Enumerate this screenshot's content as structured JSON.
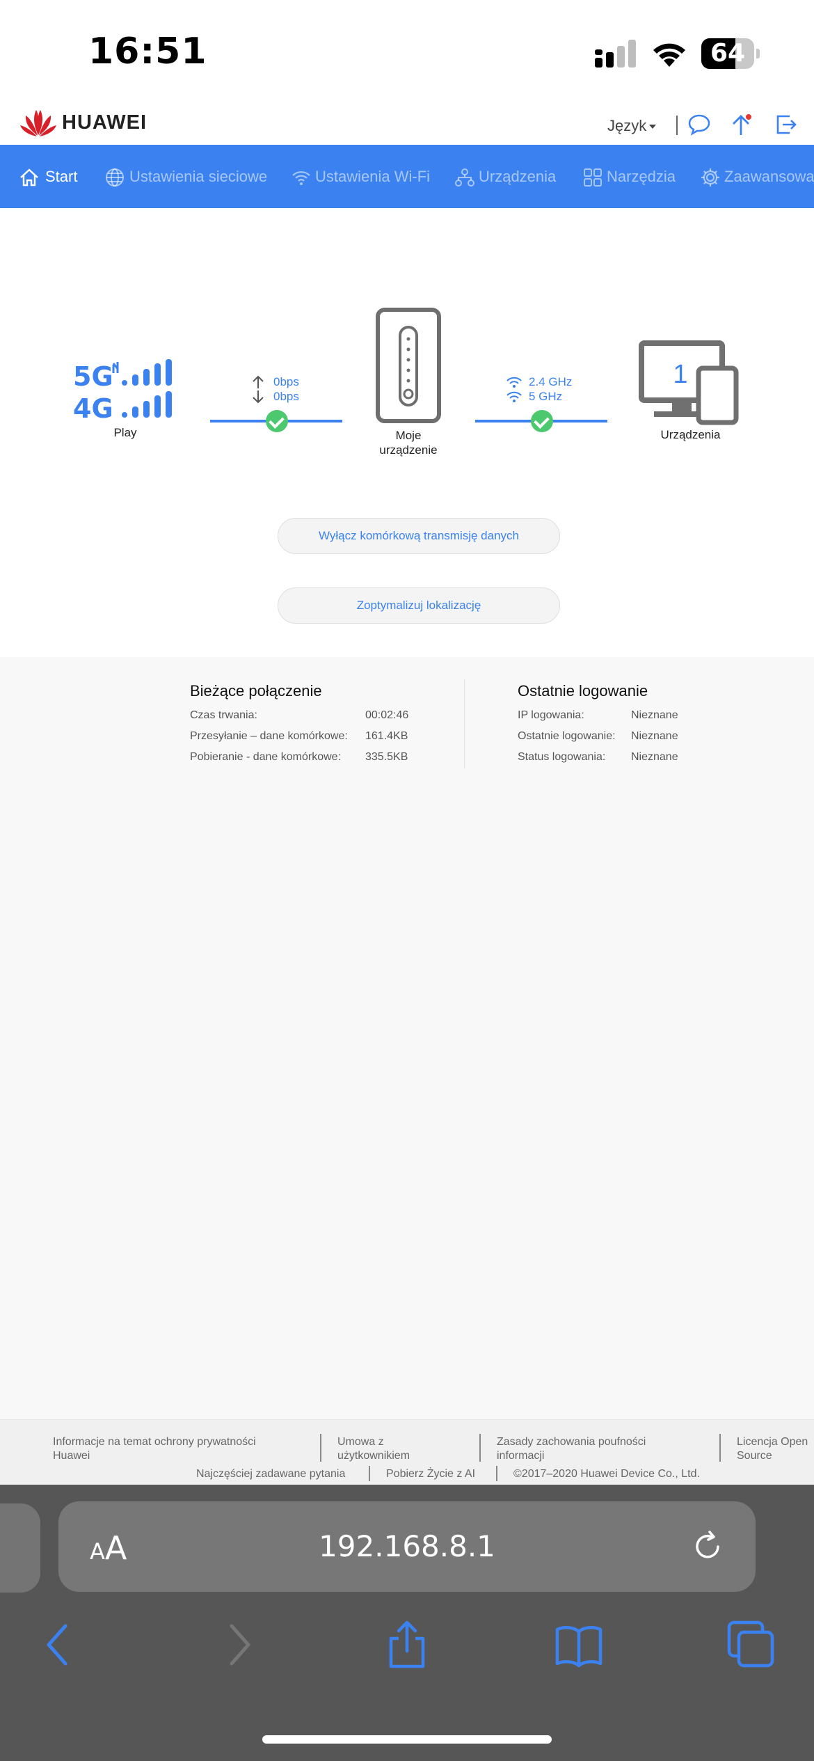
{
  "status_bar": {
    "time": "16:51",
    "battery": "64",
    "battery_level_percent": 64
  },
  "header": {
    "brand": "HUAWEI",
    "language": "Język"
  },
  "nav": {
    "items": [
      {
        "label": "Start",
        "icon": "home-icon"
      },
      {
        "label": "Ustawienia sieciowe",
        "icon": "globe-icon"
      },
      {
        "label": "Ustawienia Wi-Fi",
        "icon": "wifi-icon"
      },
      {
        "label": "Urządzenia",
        "icon": "network-icon"
      },
      {
        "label": "Narzędzia",
        "icon": "grid-icon"
      },
      {
        "label": "Zaawansowane",
        "icon": "gear-icon"
      }
    ]
  },
  "topology": {
    "operator": "Play",
    "upload_rate": "0bps",
    "download_rate": "0bps",
    "my_device_line1": "Moje",
    "my_device_line2": "urządzenie",
    "wifi_24": "2.4 GHz",
    "wifi_5": "5 GHz",
    "devices_count": "1",
    "devices_label": "Urządzenia"
  },
  "actions": {
    "disable_data": "Wyłącz komórkową transmisję danych",
    "optimize_location": "Zoptymalizuj lokalizację"
  },
  "current_connection": {
    "title": "Bieżące połączenie",
    "rows": [
      {
        "key": "Czas trwania:",
        "value": "00:02:46"
      },
      {
        "key": "Przesyłanie – dane komórkowe:",
        "value": "161.4KB"
      },
      {
        "key": "Pobieranie - dane komórkowe:",
        "value": "335.5KB"
      }
    ]
  },
  "last_login": {
    "title": "Ostatnie logowanie",
    "rows": [
      {
        "key": "IP logowania:",
        "value": "Nieznane"
      },
      {
        "key": "Ostatnie logowanie:",
        "value": "Nieznane"
      },
      {
        "key": "Status logowania:",
        "value": "Nieznane"
      }
    ]
  },
  "footer": {
    "privacy_1": "Informacje na temat ochrony prywatności",
    "privacy_2": "Huawei",
    "agreement_1": "Umowa z",
    "agreement_2": "użytkownikiem",
    "confidentiality_1": "Zasady zachowania poufności",
    "confidentiality_2": "informacji",
    "license_1": "Licencja Open",
    "license_2": "Source",
    "faq": "Najczęściej zadawane pytania",
    "download_app": "Pobierz Życie z AI",
    "copyright": "©2017–2020 Huawei Device Co., Ltd."
  },
  "browser": {
    "aa_small": "A",
    "aa_big": "A",
    "url": "192.168.8.1"
  },
  "colors": {
    "accent": "#3b82f0",
    "success": "#4cc96e",
    "device_gray": "#707070"
  }
}
